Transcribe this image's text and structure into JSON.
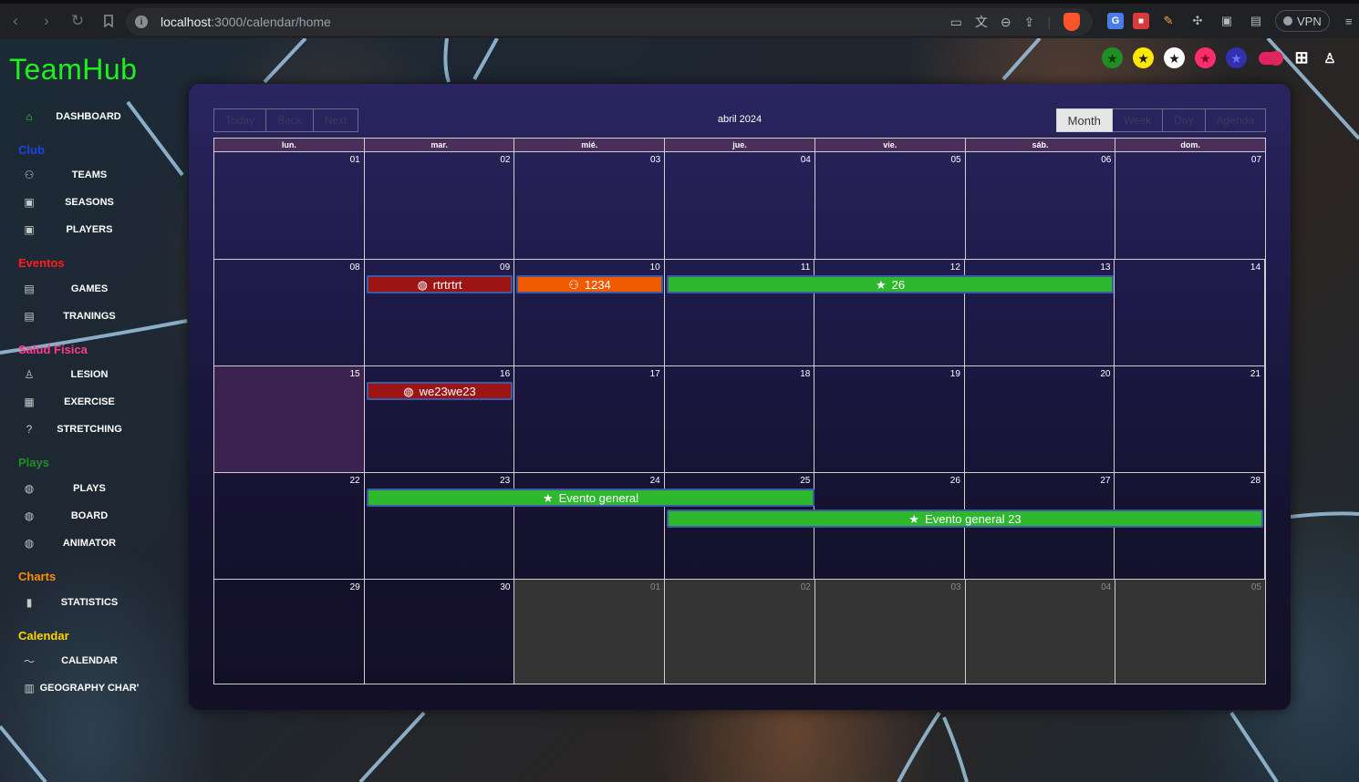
{
  "browser": {
    "url_host": "localhost",
    "url_path": ":3000/calendar/home",
    "vpn_label": "VPN"
  },
  "app": {
    "brand": "TeamHub"
  },
  "sidebar": {
    "dashboard": {
      "label": "DASHBOARD",
      "icon": "home-icon"
    },
    "sections": [
      {
        "title": "Club",
        "color": "#1a44e8",
        "items": [
          {
            "label": "TEAMS",
            "icon": "group-icon"
          },
          {
            "label": "SEASONS",
            "icon": "badge-icon"
          },
          {
            "label": "PLAYERS",
            "icon": "badge-icon"
          }
        ]
      },
      {
        "title": "Eventos",
        "color": "#ff1d1d",
        "items": [
          {
            "label": "GAMES",
            "icon": "list-icon"
          },
          {
            "label": "TRANINGS",
            "icon": "list-icon"
          }
        ]
      },
      {
        "title": "Salud Física",
        "color": "#ff3a8c",
        "items": [
          {
            "label": "LESION",
            "icon": "person-icon"
          },
          {
            "label": "EXERCISE",
            "icon": "calendar-icon"
          },
          {
            "label": "STRETCHING",
            "icon": "help-icon"
          }
        ]
      },
      {
        "title": "Plays",
        "color": "#1f8f24",
        "items": [
          {
            "label": "PLAYS",
            "icon": "ball-icon"
          },
          {
            "label": "BOARD",
            "icon": "ball-icon"
          },
          {
            "label": "ANIMATOR",
            "icon": "ball-icon"
          }
        ]
      },
      {
        "title": "Charts",
        "color": "#ff8c00",
        "items": [
          {
            "label": "STATISTICS",
            "icon": "bar-chart-icon"
          }
        ]
      },
      {
        "title": "Calendar",
        "color": "#ffd500",
        "items": [
          {
            "label": "CALENDAR",
            "icon": "trend-icon"
          },
          {
            "label": "GEOGRAPHY CHAR'",
            "icon": "map-icon"
          }
        ]
      }
    ]
  },
  "top_icons": [
    {
      "name": "green-star-icon",
      "bg": "#1f8f24",
      "fg": "#0b3d0e"
    },
    {
      "name": "yellow-star-icon",
      "bg": "#ffe800",
      "fg": "#1a1a1a"
    },
    {
      "name": "white-star-icon",
      "bg": "#ffffff",
      "fg": "#1a1a1a"
    },
    {
      "name": "pink-star-icon",
      "bg": "#ff2d6b",
      "fg": "#7a0a2a"
    },
    {
      "name": "blue-star-icon",
      "bg": "#3030b0",
      "fg": "#7070ff"
    }
  ],
  "calendar": {
    "toolbar": {
      "today": "Today",
      "back": "Back",
      "next": "Next",
      "title": "abril 2024",
      "views": [
        "Month",
        "Week",
        "Day",
        "Agenda"
      ],
      "active_view": "Month"
    },
    "weekdays": [
      "lun.",
      "mar.",
      "mié.",
      "jue.",
      "vie.",
      "sáb.",
      "dom."
    ],
    "weeks": [
      [
        "01",
        "02",
        "03",
        "04",
        "05",
        "06",
        "07"
      ],
      [
        "08",
        "09",
        "10",
        "11",
        "12",
        "13",
        "14"
      ],
      [
        "15",
        "16",
        "17",
        "18",
        "19",
        "20",
        "21"
      ],
      [
        "22",
        "23",
        "24",
        "25",
        "26",
        "27",
        "28"
      ],
      [
        "29",
        "30",
        "01",
        "02",
        "03",
        "04",
        "05"
      ]
    ],
    "today_cell": "15",
    "events": [
      {
        "title": "rtrtrtrt",
        "type": "game",
        "icon": "basketball-icon",
        "color": "#9c1414"
      },
      {
        "title": "1234",
        "type": "training",
        "icon": "team-icon",
        "color": "#f05a00"
      },
      {
        "title": "26",
        "type": "general",
        "icon": "star-icon",
        "color": "#2eb82e"
      },
      {
        "title": "we23we23",
        "type": "game",
        "icon": "basketball-icon",
        "color": "#9c1414"
      },
      {
        "title": "Evento general",
        "type": "general",
        "icon": "star-icon",
        "color": "#2eb82e"
      },
      {
        "title": "Evento general 23",
        "type": "general",
        "icon": "star-icon",
        "color": "#2eb82e"
      }
    ]
  }
}
